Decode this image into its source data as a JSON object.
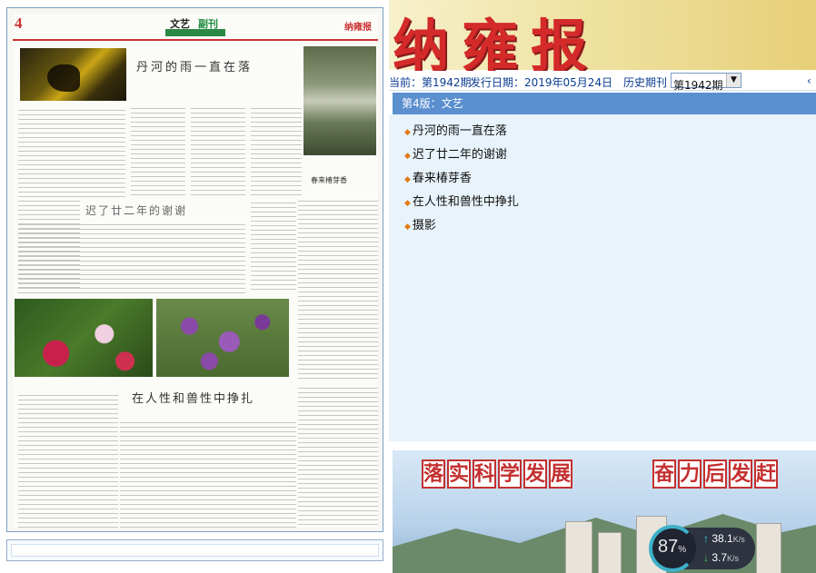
{
  "paper_page": {
    "page_number": "4",
    "section_label": "文艺",
    "section_label_green": "副刊",
    "masthead_logo": "纳雍报",
    "article_titles": {
      "a1": "丹河的雨一直在落",
      "a2": "迟了廿二年的谢谢",
      "a3": "在人性和兽性中挣扎"
    },
    "photo_caption": "春来椿芽香"
  },
  "header": {
    "paper_title": "纳雍报"
  },
  "issue_info": {
    "current_label": "当前：第1942期",
    "date_label": "发行日期：2019年05月24日",
    "history_label": "历史期刊",
    "history_selected": "第1942期",
    "back_arrow": "‹"
  },
  "section": {
    "heading": "第4版：文艺"
  },
  "articles": [
    "丹河的雨一直在落",
    "迟了廿二年的谢谢",
    "春来椿芽香",
    "在人性和兽性中挣扎",
    "摄影"
  ],
  "slogan": {
    "left_chars": [
      "落",
      "实",
      "科",
      "学",
      "发",
      "展"
    ],
    "right_chars": [
      "奋",
      "力",
      "后",
      "发",
      "赶"
    ]
  },
  "network_widget": {
    "percent": "87",
    "percent_unit": "%",
    "upload": "38.1",
    "upload_unit": "K/s",
    "download": "3.7",
    "download_unit": "K/s"
  },
  "colors": {
    "accent_blue": "#5b8fcf",
    "link_text": "#0b3d91",
    "title_red": "#d42a2a",
    "bullet_orange": "#e07a10"
  }
}
